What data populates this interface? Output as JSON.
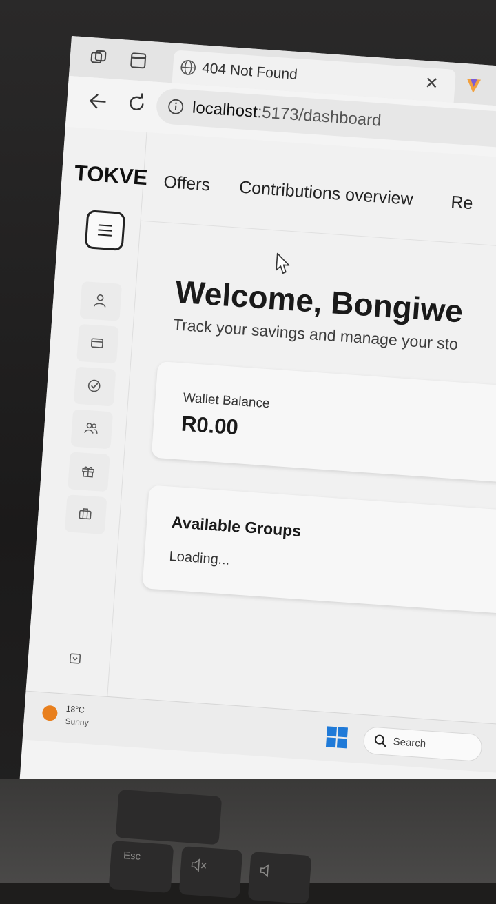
{
  "browser": {
    "tab_title": "404 Not Found",
    "url_host": "localhost",
    "url_path": ":5173/dashboard"
  },
  "app": {
    "brand": "TOKVE",
    "nav": [
      "Offers",
      "Contributions overview",
      "Re"
    ],
    "welcome": "Welcome, Bongiwe",
    "subtitle": "Track your savings and manage your sto",
    "wallet": {
      "label": "Wallet Balance",
      "value": "R0.00"
    },
    "groups": {
      "heading": "Available Groups",
      "status": "Loading..."
    },
    "sidebar_icons": [
      "user-icon",
      "card-icon",
      "check-circle-icon",
      "users-icon",
      "gift-icon",
      "briefcase-icon",
      "logout-icon"
    ]
  },
  "taskbar": {
    "temperature": "18°C",
    "condition": "Sunny",
    "search_label": "Search"
  },
  "keyboard": {
    "esc_label": "Esc"
  },
  "colors": {
    "accent_weather": "#e87f1d",
    "windows_blue": "#1f7ad8"
  }
}
